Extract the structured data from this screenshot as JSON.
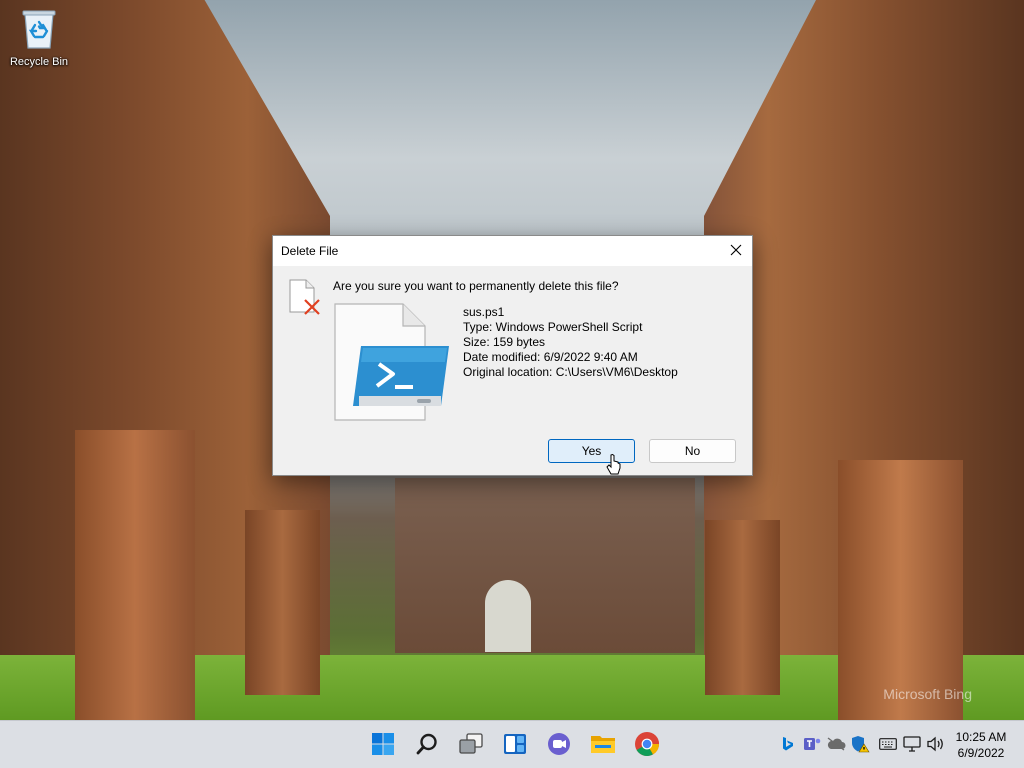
{
  "desktop": {
    "icons": [
      {
        "label": "Recycle Bin",
        "icon": "recycle-bin-icon"
      }
    ],
    "watermark": "Microsoft Bing"
  },
  "dialog": {
    "title": "Delete File",
    "question": "Are you sure you want to permanently delete this file?",
    "file": {
      "name": "sus.ps1",
      "type": "Type: Windows PowerShell Script",
      "size": "Size: 159 bytes",
      "date_modified": "Date modified: 6/9/2022 9:40 AM",
      "original_location": "Original location: C:\\Users\\VM6\\Desktop",
      "icon": "powershell-file-icon"
    },
    "buttons": {
      "yes": "Yes",
      "no": "No"
    },
    "close_icon": "close-icon"
  },
  "taskbar": {
    "apps": [
      {
        "name": "Start",
        "icon": "windows-start-icon"
      },
      {
        "name": "Search",
        "icon": "search-icon"
      },
      {
        "name": "Task View",
        "icon": "task-view-icon"
      },
      {
        "name": "Widgets",
        "icon": "widgets-icon"
      },
      {
        "name": "Teams Chat",
        "icon": "teams-chat-icon"
      },
      {
        "name": "File Explorer",
        "icon": "file-explorer-icon"
      },
      {
        "name": "Google Chrome",
        "icon": "chrome-icon"
      }
    ],
    "tray": [
      "bing-icon",
      "teams-icon",
      "onedrive-icon",
      "defender-warning-icon",
      "keyboard-icon",
      "network-icon",
      "volume-icon"
    ],
    "clock": {
      "time": "10:25 AM",
      "date": "6/9/2022"
    }
  },
  "colors": {
    "accent": "#0067c0",
    "yes_button_bg": "#e0eefa",
    "dialog_bg": "#f0f0f0",
    "taskbar_bg": "#dcdfe4"
  }
}
